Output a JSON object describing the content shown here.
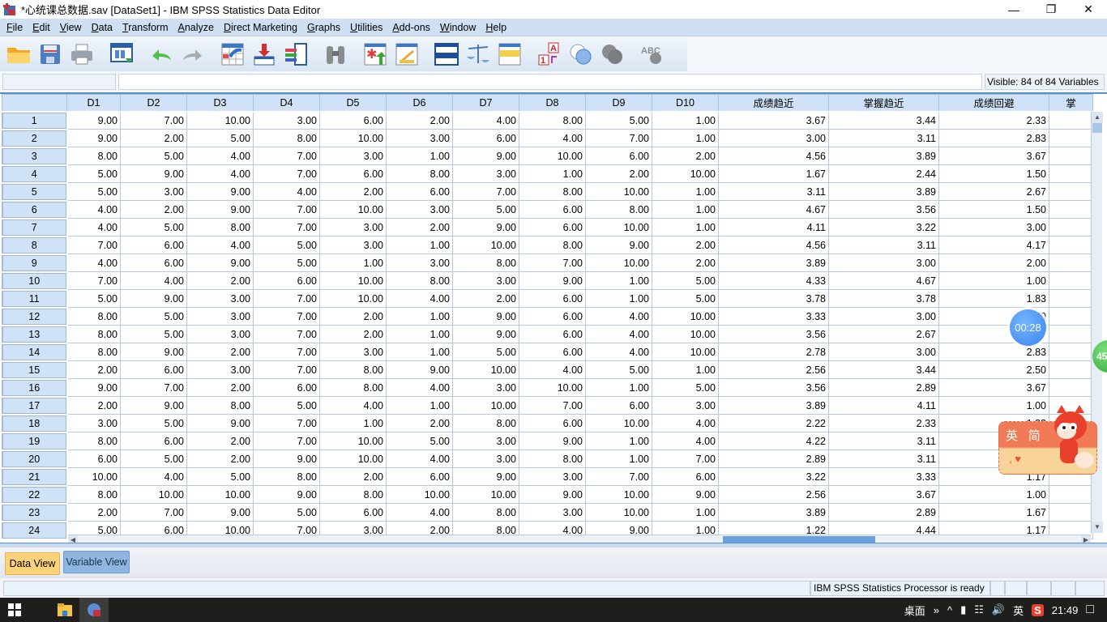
{
  "window": {
    "title": "*心统课总数据.sav [DataSet1] - IBM SPSS Statistics Data Editor",
    "controls": [
      "minimize",
      "restore",
      "close"
    ]
  },
  "menu": [
    "File",
    "Edit",
    "View",
    "Data",
    "Transform",
    "Analyze",
    "Direct Marketing",
    "Graphs",
    "Utilities",
    "Add-ons",
    "Window",
    "Help"
  ],
  "toolbar": [
    {
      "name": "open-data-document",
      "icon": "folder-icon"
    },
    {
      "name": "save-document",
      "icon": "save-icon"
    },
    {
      "name": "print",
      "icon": "print-icon"
    },
    {
      "name": "recall-dialog",
      "icon": "dialog-recall-icon"
    },
    {
      "name": "undo",
      "icon": "undo-icon"
    },
    {
      "name": "redo",
      "icon": "redo-icon"
    },
    {
      "name": "go-to-case",
      "icon": "goto-case-icon"
    },
    {
      "name": "go-to-variable",
      "icon": "goto-variable-icon"
    },
    {
      "name": "variables",
      "icon": "variables-icon"
    },
    {
      "name": "find",
      "icon": "binoculars-icon"
    },
    {
      "name": "insert-cases",
      "icon": "insert-cases-icon"
    },
    {
      "name": "insert-variable",
      "icon": "insert-variable-icon"
    },
    {
      "name": "split-file",
      "icon": "split-file-icon"
    },
    {
      "name": "weight-cases",
      "icon": "scale-icon"
    },
    {
      "name": "select-cases",
      "icon": "select-cases-icon"
    },
    {
      "name": "value-labels",
      "icon": "value-labels-icon"
    },
    {
      "name": "use-variable-sets",
      "icon": "variable-sets-icon"
    },
    {
      "name": "show-all-variables",
      "icon": "show-all-icon"
    },
    {
      "name": "spell-check",
      "icon": "spellcheck-icon"
    }
  ],
  "cellbar": {
    "cell_ref": "",
    "cell_value": "",
    "visible_label": "Visible: 84 of 84 Variables"
  },
  "grid": {
    "columns": [
      "D1",
      "D2",
      "D3",
      "D4",
      "D5",
      "D6",
      "D7",
      "D8",
      "D9",
      "D10",
      "成绩趋近",
      "掌握趋近",
      "成绩回避",
      "掌"
    ],
    "rows": [
      {
        "n": "1",
        "v": [
          "9.00",
          "7.00",
          "10.00",
          "3.00",
          "6.00",
          "2.00",
          "4.00",
          "8.00",
          "5.00",
          "1.00",
          "3.67",
          "3.44",
          "2.33",
          ""
        ]
      },
      {
        "n": "2",
        "v": [
          "9.00",
          "2.00",
          "5.00",
          "8.00",
          "10.00",
          "3.00",
          "6.00",
          "4.00",
          "7.00",
          "1.00",
          "3.00",
          "3.11",
          "2.83",
          ""
        ]
      },
      {
        "n": "3",
        "v": [
          "8.00",
          "5.00",
          "4.00",
          "7.00",
          "3.00",
          "1.00",
          "9.00",
          "10.00",
          "6.00",
          "2.00",
          "4.56",
          "3.89",
          "3.67",
          ""
        ]
      },
      {
        "n": "4",
        "v": [
          "5.00",
          "9.00",
          "4.00",
          "7.00",
          "6.00",
          "8.00",
          "3.00",
          "1.00",
          "2.00",
          "10.00",
          "1.67",
          "2.44",
          "1.50",
          ""
        ]
      },
      {
        "n": "5",
        "v": [
          "5.00",
          "3.00",
          "9.00",
          "4.00",
          "2.00",
          "6.00",
          "7.00",
          "8.00",
          "10.00",
          "1.00",
          "3.11",
          "3.89",
          "2.67",
          ""
        ]
      },
      {
        "n": "6",
        "v": [
          "4.00",
          "2.00",
          "9.00",
          "7.00",
          "10.00",
          "3.00",
          "5.00",
          "6.00",
          "8.00",
          "1.00",
          "4.67",
          "3.56",
          "1.50",
          ""
        ]
      },
      {
        "n": "7",
        "v": [
          "4.00",
          "5.00",
          "8.00",
          "7.00",
          "3.00",
          "2.00",
          "9.00",
          "6.00",
          "10.00",
          "1.00",
          "4.11",
          "3.22",
          "3.00",
          ""
        ]
      },
      {
        "n": "8",
        "v": [
          "7.00",
          "6.00",
          "4.00",
          "5.00",
          "3.00",
          "1.00",
          "10.00",
          "8.00",
          "9.00",
          "2.00",
          "4.56",
          "3.11",
          "4.17",
          ""
        ]
      },
      {
        "n": "9",
        "v": [
          "4.00",
          "6.00",
          "9.00",
          "5.00",
          "1.00",
          "3.00",
          "8.00",
          "7.00",
          "10.00",
          "2.00",
          "3.89",
          "3.00",
          "2.00",
          ""
        ]
      },
      {
        "n": "10",
        "v": [
          "7.00",
          "4.00",
          "2.00",
          "6.00",
          "10.00",
          "8.00",
          "3.00",
          "9.00",
          "1.00",
          "5.00",
          "4.33",
          "4.67",
          "1.00",
          ""
        ]
      },
      {
        "n": "11",
        "v": [
          "5.00",
          "9.00",
          "3.00",
          "7.00",
          "10.00",
          "4.00",
          "2.00",
          "6.00",
          "1.00",
          "5.00",
          "3.78",
          "3.78",
          "1.83",
          ""
        ]
      },
      {
        "n": "12",
        "v": [
          "8.00",
          "5.00",
          "3.00",
          "7.00",
          "2.00",
          "1.00",
          "9.00",
          "6.00",
          "4.00",
          "10.00",
          "3.33",
          "3.00",
          "2.50",
          ""
        ]
      },
      {
        "n": "13",
        "v": [
          "8.00",
          "5.00",
          "3.00",
          "7.00",
          "2.00",
          "1.00",
          "9.00",
          "6.00",
          "4.00",
          "10.00",
          "3.56",
          "2.67",
          "2.67",
          ""
        ]
      },
      {
        "n": "14",
        "v": [
          "8.00",
          "9.00",
          "2.00",
          "7.00",
          "3.00",
          "1.00",
          "5.00",
          "6.00",
          "4.00",
          "10.00",
          "2.78",
          "3.00",
          "2.83",
          ""
        ]
      },
      {
        "n": "15",
        "v": [
          "2.00",
          "6.00",
          "3.00",
          "7.00",
          "8.00",
          "9.00",
          "10.00",
          "4.00",
          "5.00",
          "1.00",
          "2.56",
          "3.44",
          "2.50",
          ""
        ]
      },
      {
        "n": "16",
        "v": [
          "9.00",
          "7.00",
          "2.00",
          "6.00",
          "8.00",
          "4.00",
          "3.00",
          "10.00",
          "1.00",
          "5.00",
          "3.56",
          "2.89",
          "3.67",
          ""
        ]
      },
      {
        "n": "17",
        "v": [
          "2.00",
          "9.00",
          "8.00",
          "5.00",
          "4.00",
          "1.00",
          "10.00",
          "7.00",
          "6.00",
          "3.00",
          "3.89",
          "4.11",
          "1.00",
          ""
        ]
      },
      {
        "n": "18",
        "v": [
          "3.00",
          "5.00",
          "9.00",
          "7.00",
          "1.00",
          "2.00",
          "8.00",
          "6.00",
          "10.00",
          "4.00",
          "2.22",
          "2.33",
          "1.33",
          ""
        ]
      },
      {
        "n": "19",
        "v": [
          "8.00",
          "6.00",
          "2.00",
          "7.00",
          "10.00",
          "5.00",
          "3.00",
          "9.00",
          "1.00",
          "4.00",
          "4.22",
          "3.11",
          "",
          ""
        ]
      },
      {
        "n": "20",
        "v": [
          "6.00",
          "5.00",
          "2.00",
          "9.00",
          "10.00",
          "4.00",
          "3.00",
          "8.00",
          "1.00",
          "7.00",
          "2.89",
          "3.11",
          "",
          ""
        ]
      },
      {
        "n": "21",
        "v": [
          "10.00",
          "4.00",
          "5.00",
          "8.00",
          "2.00",
          "6.00",
          "9.00",
          "3.00",
          "7.00",
          "6.00",
          "3.22",
          "3.33",
          "1.17",
          ""
        ]
      },
      {
        "n": "22",
        "v": [
          "8.00",
          "10.00",
          "10.00",
          "9.00",
          "8.00",
          "10.00",
          "10.00",
          "9.00",
          "10.00",
          "9.00",
          "2.56",
          "3.67",
          "1.00",
          ""
        ]
      },
      {
        "n": "23",
        "v": [
          "2.00",
          "7.00",
          "9.00",
          "5.00",
          "6.00",
          "4.00",
          "8.00",
          "3.00",
          "10.00",
          "1.00",
          "3.89",
          "2.89",
          "1.67",
          ""
        ]
      },
      {
        "n": "24",
        "v": [
          "5.00",
          "6.00",
          "10.00",
          "7.00",
          "3.00",
          "2.00",
          "8.00",
          "4.00",
          "9.00",
          "1.00",
          "1.22",
          "4.44",
          "1.17",
          ""
        ]
      }
    ]
  },
  "tabs": [
    {
      "label": "Data View",
      "active": true
    },
    {
      "label": "Variable View",
      "active": false
    }
  ],
  "status": {
    "text": "IBM SPSS Statistics Processor is ready"
  },
  "overlays": {
    "timer": "00:28",
    "green_badge": "45",
    "ime_label": "英 简"
  },
  "taskbar": {
    "tray": [
      "桌面",
      "»",
      "^",
      "英"
    ],
    "time": "21:49"
  },
  "colors": {
    "menubar": "#cfe0f2",
    "header": "#cfe2f7",
    "active_tab": "#fdd27b",
    "inactive_tab": "#8eb6df",
    "taskbar": "#1e1f1d"
  }
}
